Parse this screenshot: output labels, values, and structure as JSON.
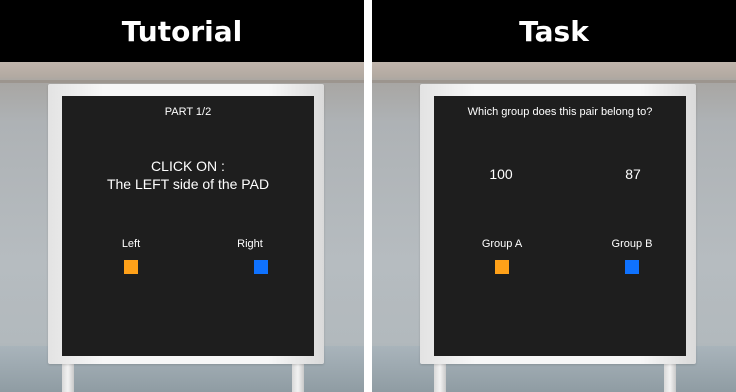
{
  "left_panel": {
    "title": "Tutorial",
    "header": "PART 1/2",
    "instruction_line1": "CLICK ON :",
    "instruction_line2": "The LEFT side of the PAD",
    "option_left_label": "Left",
    "option_right_label": "Right"
  },
  "right_panel": {
    "title": "Task",
    "question": "Which group does this pair belong to?",
    "value_left": "100",
    "value_right": "87",
    "option_left_label": "Group A",
    "option_right_label": "Group B"
  },
  "colors": {
    "option_a": "#ffa119",
    "option_b": "#0f72ff",
    "board": "#1e1e1e"
  }
}
